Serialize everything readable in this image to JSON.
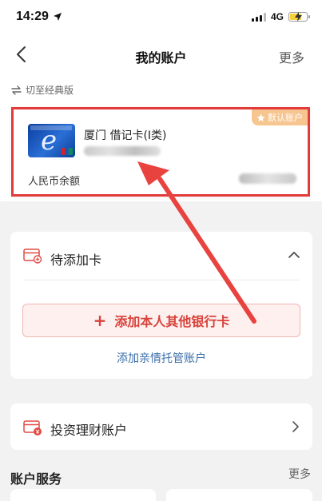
{
  "status_bar": {
    "time": "14:29",
    "network": "4G",
    "battery_level": 0.65,
    "battery_color": "#f6d23a"
  },
  "nav": {
    "title": "我的账户",
    "more_label": "更多",
    "back_icon": "chevron-left-icon"
  },
  "switch_link": {
    "label": "切至经典版",
    "icon": "swap-arrows-icon"
  },
  "account_card": {
    "default_badge": "默认账户",
    "badge_icon": "star-icon",
    "bank_logo_letter": "e",
    "card_name": "厦门 借记卡(Ⅰ类)",
    "balance_label": "人民币余额",
    "highlight_color": "#e33a3a"
  },
  "pending_cards": {
    "title": "待添加卡",
    "add_button_label": "添加本人其他银行卡",
    "add_button_plus": "+",
    "family_link": "添加亲情托管账户"
  },
  "invest_account": {
    "title": "投资理财账户"
  },
  "services": {
    "title": "账户服务",
    "more_label": "更多"
  },
  "colors": {
    "accent_red": "#d8423a",
    "link_blue": "#3a6ea8",
    "badge_orange": "#f7c690"
  }
}
